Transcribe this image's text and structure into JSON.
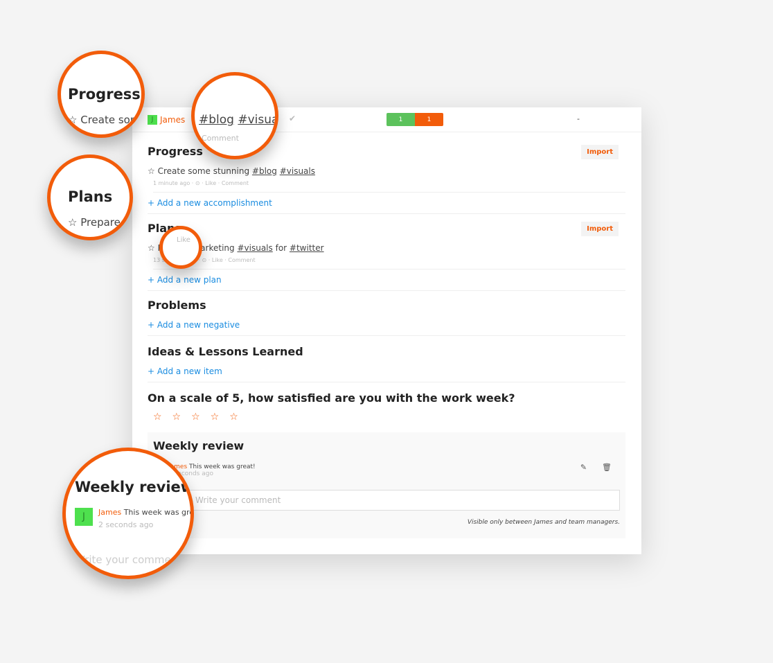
{
  "header": {
    "user": "James",
    "avatar": "J",
    "bar_green": "1",
    "bar_orange": "1",
    "dash": "-"
  },
  "progress": {
    "title": "Progress",
    "import": "Import",
    "item_text": "Create some stunning",
    "tag1": "#blog",
    "tag2": "#visuals",
    "time": "1 minute ago",
    "like": "Like",
    "comment": "Comment",
    "add": "+ Add a new accomplishment"
  },
  "plans": {
    "title": "Plans",
    "import": "Import",
    "item_pre": "Prepare marketing",
    "tag1": "#visuals",
    "mid": "for",
    "tag2": "#twitter",
    "time": "13 seconds ago",
    "like": "Like",
    "comment": "Comment",
    "add": "+ Add a new plan"
  },
  "problems": {
    "title": "Problems",
    "add": "+ Add a new negative"
  },
  "ideas": {
    "title": "Ideas & Lessons Learned",
    "add": "+ Add a new item"
  },
  "rating": {
    "question": "On a scale of 5, how satisfied are you with the work week?",
    "stars": "☆☆☆☆☆",
    "value": 0,
    "max": 5
  },
  "review": {
    "title": "Weekly review",
    "user": "James",
    "text": "This week was great!",
    "time": "2 seconds ago",
    "placeholder": "Write your comment",
    "visibility": "Visible only between James and team managers."
  },
  "zoom": {
    "progress_item": "Create some",
    "add_partial": "+ Add a n",
    "plans_item": "Prepare",
    "review_text": "This week was grea",
    "placeholder": "Write your comment"
  },
  "colors": {
    "accent": "#f25c0a",
    "link": "#1a8ce0",
    "green": "#5cc25c"
  }
}
